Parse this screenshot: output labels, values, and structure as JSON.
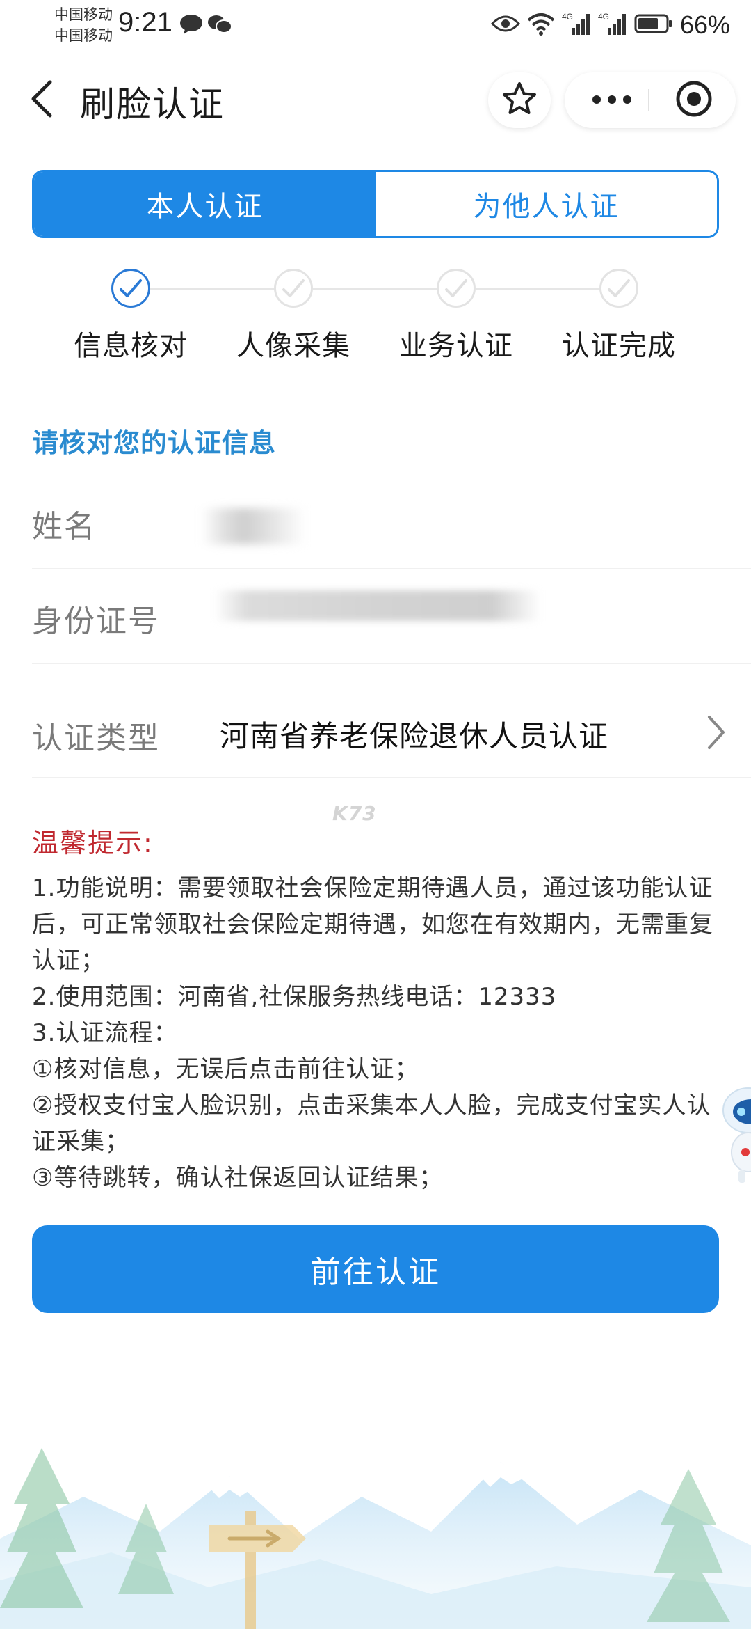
{
  "status_bar": {
    "carrier_1": "中国移动",
    "carrier_2": "中国移动",
    "time": "9:21",
    "battery_text": "66%",
    "icons": [
      "message-icon",
      "wechat-icon",
      "eye-icon",
      "wifi-icon",
      "signal-4g-icon",
      "signal-4g-icon",
      "battery-icon"
    ]
  },
  "nav": {
    "title": "刷脸认证",
    "icons": [
      "back-chevron-icon",
      "star-icon",
      "more-icon",
      "close-circle-icon"
    ]
  },
  "tabs": [
    {
      "label": "本人认证",
      "active": true
    },
    {
      "label": "为他人认证",
      "active": false
    }
  ],
  "steps": [
    {
      "label": "信息核对",
      "done": true
    },
    {
      "label": "人像采集",
      "done": false
    },
    {
      "label": "业务认证",
      "done": false
    },
    {
      "label": "认证完成",
      "done": false
    }
  ],
  "form": {
    "section_title": "请核对您的认证信息",
    "name_label": "姓名",
    "id_label": "身份证号",
    "type_label": "认证类型",
    "type_value": "河南省养老保险退休人员认证"
  },
  "watermark": "K73",
  "tips": {
    "title": "温馨提示:",
    "lines": [
      "1.功能说明：需要领取社会保险定期待遇人员，通过该功能认证后，可正常领取社会保险定期待遇，如您在有效期内，无需重复认证；",
      "2.使用范围：河南省,社保服务热线电话：12333",
      "3.认证流程：",
      "①核对信息，无误后点击前往认证；",
      "②授权支付宝人脸识别，点击采集本人人脸，完成支付宝实人认证采集；",
      "③等待跳转，确认社保返回认证结果；"
    ]
  },
  "button_label": "前往认证",
  "colors": {
    "primary": "#1e88e5",
    "section_title": "#2a8bd0",
    "tips_title": "#c0282f"
  }
}
